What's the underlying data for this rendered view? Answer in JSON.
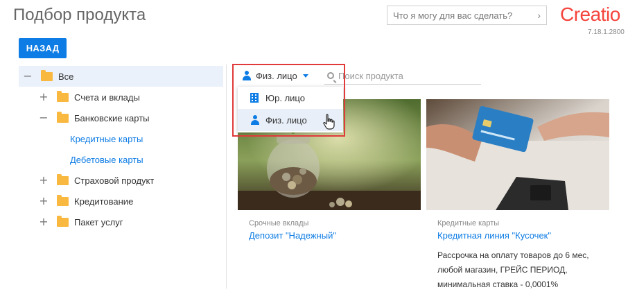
{
  "page": {
    "title": "Подбор продукта"
  },
  "assistant": {
    "placeholder": "Что я могу для вас сделать?",
    "arrow_icon": "chevron-right-icon"
  },
  "brand": {
    "logo_text": "Creatio",
    "version": "7.18.1.2800",
    "color": "#f5443d"
  },
  "toolbar": {
    "back_label": "НАЗАД"
  },
  "tree": {
    "items": [
      {
        "label": "Все",
        "toggle": "−",
        "icon": "folder-icon",
        "selected": true
      },
      {
        "label": "Счета и вклады",
        "toggle": "+",
        "icon": "folder-icon"
      },
      {
        "label": "Банковские карты",
        "toggle": "−",
        "icon": "folder-icon"
      },
      {
        "label": "Кредитные карты",
        "link": true
      },
      {
        "label": "Дебетовые карты",
        "link": true
      },
      {
        "label": "Страховой продукт",
        "toggle": "+",
        "icon": "folder-icon"
      },
      {
        "label": "Кредитование",
        "toggle": "+",
        "icon": "folder-icon"
      },
      {
        "label": "Пакет услуг",
        "toggle": "+",
        "icon": "folder-icon"
      }
    ]
  },
  "filter": {
    "selected_type": "Физ. лицо",
    "search_placeholder": "Поиск продукта",
    "options": [
      {
        "label": "Юр. лицо",
        "icon": "building-icon"
      },
      {
        "label": "Физ. лицо",
        "icon": "person-icon",
        "active": true
      }
    ]
  },
  "products": [
    {
      "category": "Срочные вклады",
      "name": "Депозит \"Надежный\"",
      "description": ""
    },
    {
      "category": "Кредитные карты",
      "name": "Кредитная линия \"Кусочек\"",
      "description": "Рассрочка на оплату товаров до 6 мес, любой магазин, ГРЕЙС ПЕРИОД, минимальная ставка - 0,0001%"
    }
  ],
  "colors": {
    "accent": "#0d7ce4",
    "highlight": "#e03a3a",
    "folder": "#f9b840"
  }
}
